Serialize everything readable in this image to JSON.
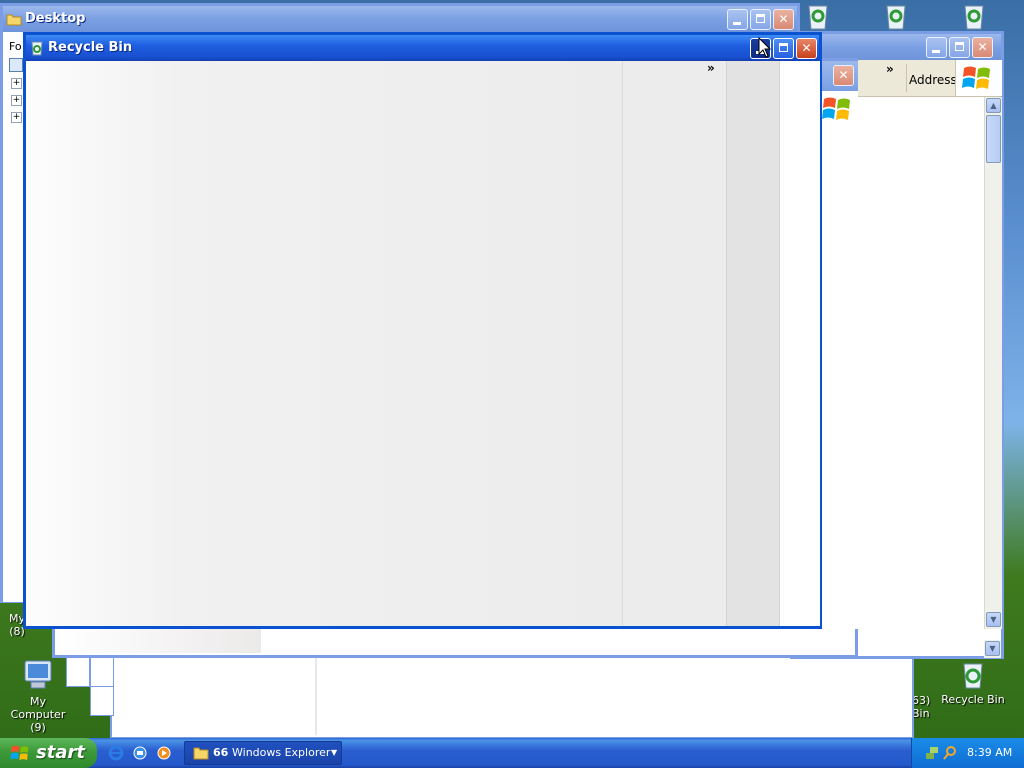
{
  "desktop_window": {
    "title": "Desktop",
    "folders_label": "Fo"
  },
  "back_window": {
    "address_label": "Address",
    "chevron": "»"
  },
  "recycle_window": {
    "title": "Recycle Bin",
    "chevron": "»"
  },
  "desktop_icons": {
    "my_computer_label": "My Computer",
    "my_computer_count": "(9)",
    "my_left_label": "My",
    "my_left_count": "(8)",
    "recycle_bin_label": "Recycle Bin",
    "recycle_partial_count": "63)",
    "recycle_partial_bin": "Bin"
  },
  "taskbar": {
    "start_label": "start",
    "task_count": "66",
    "task_label": "Windows Explorer",
    "clock": "8:39 AM"
  },
  "icons": {
    "folder": "folder-icon",
    "recycle": "recycle-bin-icon",
    "windows_logo": "windows-logo-icon",
    "ie": "internet-explorer-icon",
    "media_player": "media-player-icon"
  },
  "colors": {
    "title_active": "#1f5ee0",
    "title_inactive": "#7a9fe3",
    "taskbar": "#2459cb",
    "start_green": "#3c9a3a",
    "close_red": "#c8401c"
  }
}
